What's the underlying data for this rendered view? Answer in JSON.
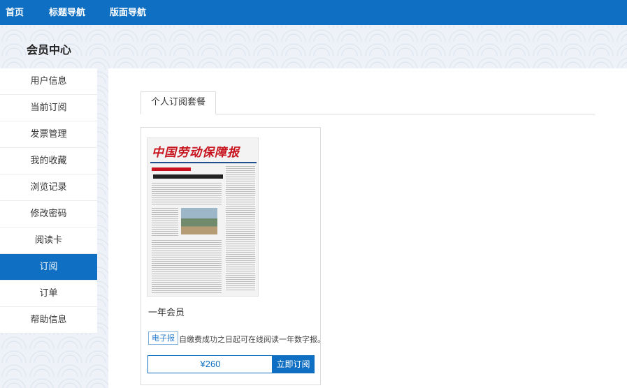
{
  "topnav": {
    "home": "首页",
    "title_nav": "标题导航",
    "layout_nav": "版面导航"
  },
  "page": {
    "section_title": "会员中心"
  },
  "sidebar": {
    "items": [
      {
        "label": "用户信息"
      },
      {
        "label": "当前订阅"
      },
      {
        "label": "发票管理"
      },
      {
        "label": "我的收藏"
      },
      {
        "label": "浏览记录"
      },
      {
        "label": "修改密码"
      },
      {
        "label": "阅读卡"
      },
      {
        "label": "订阅",
        "active": true
      },
      {
        "label": "订单"
      },
      {
        "label": "帮助信息"
      }
    ]
  },
  "main": {
    "tab_label": "个人订阅套餐",
    "product": {
      "name": "一年会员",
      "tag": "电子报",
      "description": "自缴费成功之日起可在线阅读一年数字报。",
      "price": "¥260",
      "subscribe_label": "立即订阅",
      "cover_masthead": "中国劳动保障报"
    }
  },
  "colors": {
    "primary": "#0f6fc2",
    "masthead_red": "#c8141e"
  }
}
